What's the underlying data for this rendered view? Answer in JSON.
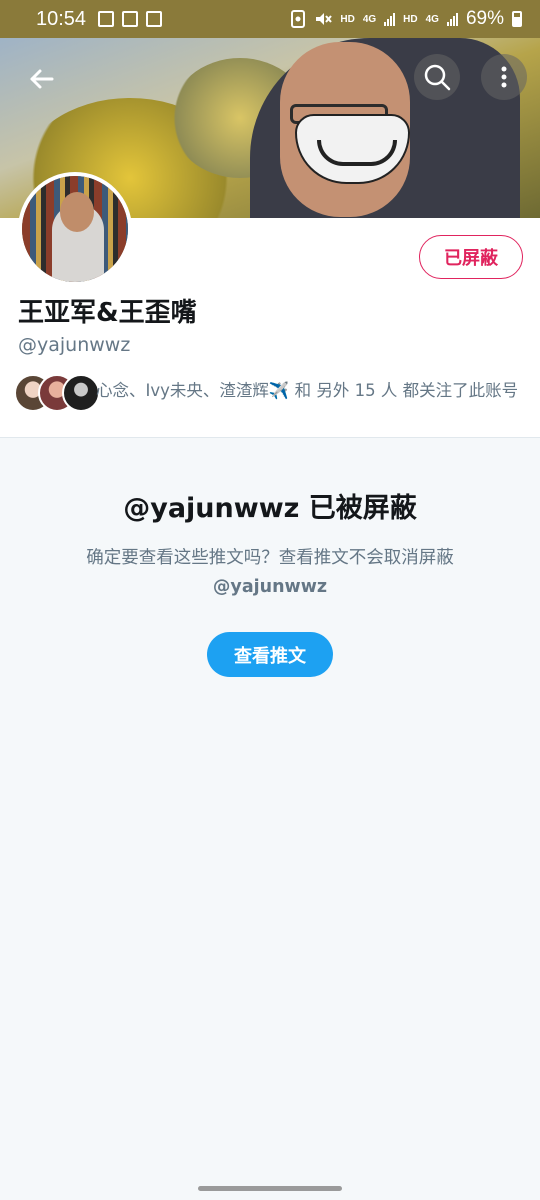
{
  "status_bar": {
    "time": "10:54",
    "network_1": "HD",
    "network_2": "HD",
    "gen_1": "4G",
    "gen_2": "4G",
    "battery": "69%",
    "battery_level": 0.69
  },
  "header": {
    "back_icon": "arrow-left-icon",
    "search_icon": "search-icon",
    "more_icon": "more-vertical-icon"
  },
  "profile": {
    "blocked_button": "已屏蔽",
    "display_name": "王亚军&王歪嘴",
    "handle": "@yajunwwz",
    "followers_text": "心念、Ivy未央、渣渣辉✈️ 和 另外 15 人 都关注了此账号"
  },
  "blocked_notice": {
    "title": "@yajunwwz 已被屏蔽",
    "body": "确定要查看这些推文吗？查看推文不会取消屏蔽",
    "handle": "@yajunwwz",
    "view_button": "查看推文"
  },
  "colors": {
    "block_red": "#e0245e",
    "primary_blue": "#1da1f2",
    "text_dark": "#14171a",
    "text_gray": "#657786",
    "background": "#f5f8fa"
  }
}
